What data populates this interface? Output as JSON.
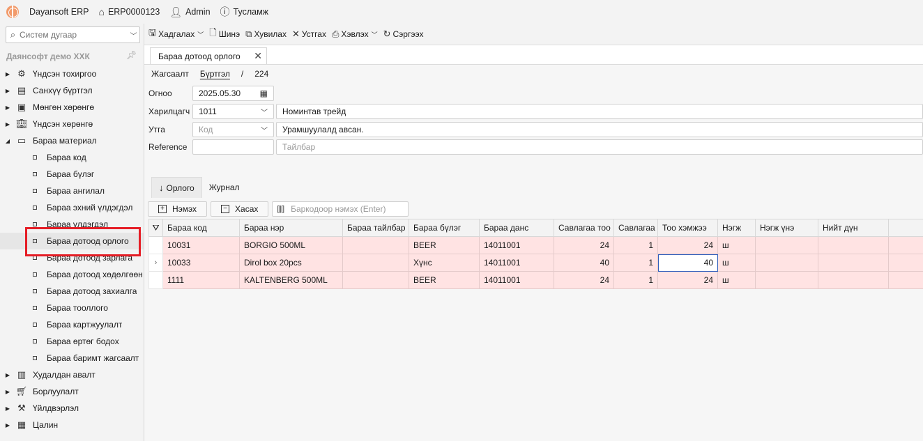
{
  "titlebar": {
    "app_name": "Dayansoft ERP",
    "home_code": "ERP0000123",
    "user": "Admin",
    "help": "Тусламж"
  },
  "left": {
    "search_placeholder": "Систем дугаар",
    "company": "Даянсофт демо ХХК",
    "tree": [
      {
        "label": "Үндсэн тохиргоо",
        "icon": "gear-icon",
        "expanded": false
      },
      {
        "label": "Санхүү бүртгэл",
        "icon": "ledger-icon",
        "expanded": false
      },
      {
        "label": "Мөнгөн хөрөнгө",
        "icon": "money-icon",
        "expanded": false
      },
      {
        "label": "Үндсэн хөрөнгө",
        "icon": "building-icon",
        "expanded": false
      },
      {
        "label": "Бараа материал",
        "icon": "box-icon",
        "expanded": true,
        "children": [
          "Бараа код",
          "Бараа бүлэг",
          "Бараа ангилал",
          "Бараа эхний үлдэгдэл",
          "Бараа үлдэгдэл",
          "Бараа дотоод орлого",
          "Бараа дотоод зарлага",
          "Бараа дотоод хөдөлгөөн",
          "Бараа дотоод захиалга",
          "Бараа тооллого",
          "Бараа картжуулалт",
          "Бараа өртөг бодох",
          "Бараа баримт жагсаалт"
        ]
      },
      {
        "label": "Худалдан авалт",
        "icon": "purchase-icon",
        "expanded": false
      },
      {
        "label": "Борлуулалт",
        "icon": "cart-icon",
        "expanded": false
      },
      {
        "label": "Үйлдвэрлэл",
        "icon": "factory-icon",
        "expanded": false
      },
      {
        "label": "Цалин",
        "icon": "payroll-icon",
        "expanded": false
      }
    ],
    "selected_child": "Бараа дотоод орлого"
  },
  "toolbar": {
    "save": "Хадгалах",
    "new": "Шинэ",
    "copy": "Хувилах",
    "delete": "Устгах",
    "print": "Хэвлэх",
    "refresh": "Сэргээх"
  },
  "doc": {
    "tab_title": "Бараа дотоод орлого",
    "crumbs": {
      "list": "Жагсаалт",
      "register": "Бүртгэл",
      "sep": "/",
      "number": "224"
    },
    "form": {
      "date_label": "Огноо",
      "date_value": "2025.05.30",
      "partner_label": "Харилцагч",
      "partner_code": "1011",
      "partner_name": "Номинтав трейд",
      "meaning_label": "Утга",
      "meaning_code_placeholder": "Код",
      "meaning_text": "Урамшуулалд авсан.",
      "reference_label": "Reference",
      "reference_value": "",
      "description_placeholder": "Тайлбар"
    },
    "subtabs": {
      "income": "Орлого",
      "journal": "Журнал"
    },
    "gridbar": {
      "add": "Нэмэх",
      "remove": "Хасах",
      "barcode_placeholder": "Баркодоор нэмэх (Enter)"
    },
    "grid": {
      "columns": [
        "Бараа код",
        "Бараа нэр",
        "Бараа тайлбар",
        "Бараа бүлэг",
        "Бараа данс",
        "Савлагаа тоо",
        "Савлагаа",
        "Тоо хэмжээ",
        "Нэгж",
        "Нэгж үнэ",
        "Нийт дүн"
      ],
      "rows": [
        {
          "code": "10031",
          "name": "BORGIO 500ML",
          "desc": "",
          "group": "BEER",
          "account": "14011001",
          "pack_qty": "24",
          "pack": "1",
          "qty": "24",
          "unit": "ш",
          "price": "",
          "total": ""
        },
        {
          "code": "10033",
          "name": "Dirol box 20pcs",
          "desc": "",
          "group": "Хүнс",
          "account": "14011001",
          "pack_qty": "40",
          "pack": "1",
          "qty": "40",
          "unit": "ш",
          "price": "",
          "total": ""
        },
        {
          "code": "1111",
          "name": "KALTENBERG 500ML",
          "desc": "",
          "group": "BEER",
          "account": "14011001",
          "pack_qty": "24",
          "pack": "1",
          "qty": "24",
          "unit": "ш",
          "price": "",
          "total": ""
        }
      ]
    }
  }
}
